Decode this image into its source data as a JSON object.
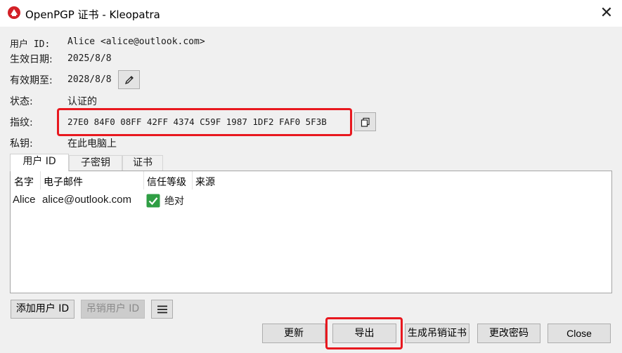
{
  "window": {
    "title": "OpenPGP 证书 - Kleopatra",
    "close_glyph": "✕"
  },
  "details": {
    "user_id_label": "用户 ID:",
    "user_id_value": "Alice <alice@outlook.com>",
    "valid_from_label": "生效日期:",
    "valid_from_value": "2025/8/8",
    "expires_label": "有效期至:",
    "expires_value": "2028/8/8",
    "status_label": "状态:",
    "status_value": "认证的",
    "fingerprint_label": "指纹:",
    "fingerprint_value": "27E0 84F0 08FF 42FF 4374  C59F 1987 1DF2 FAF0 5F3B",
    "secret_key_label": "私钥:",
    "secret_key_value": "在此电脑上"
  },
  "tabs": [
    {
      "label": "用户 ID",
      "active": true
    },
    {
      "label": "子密钥",
      "active": false
    },
    {
      "label": "证书",
      "active": false
    }
  ],
  "table": {
    "columns": [
      "名字",
      "电子邮件",
      "信任等级",
      "来源"
    ],
    "rows": [
      {
        "name": "Alice",
        "email": "alice@outlook.com",
        "trust": "绝对",
        "origin": ""
      }
    ]
  },
  "uid_actions": {
    "add_uid": "添加用户 ID",
    "revoke_uid": "吊销用户 ID"
  },
  "footer_buttons": {
    "refresh": "更新",
    "export": "导出",
    "gen_revocation": "生成吊销证书",
    "change_passphrase": "更改密码",
    "close": "Close"
  },
  "colors": {
    "highlight": "#e8181f",
    "check_green": "#2f9e44",
    "app_icon_red": "#d32027"
  },
  "icons": {
    "app": "kleopatra-app-icon",
    "edit_expiry": "pencil-icon",
    "copy_fingerprint": "copy-icon",
    "menu": "hamburger-menu-icon",
    "trust_check": "green-check-icon"
  }
}
